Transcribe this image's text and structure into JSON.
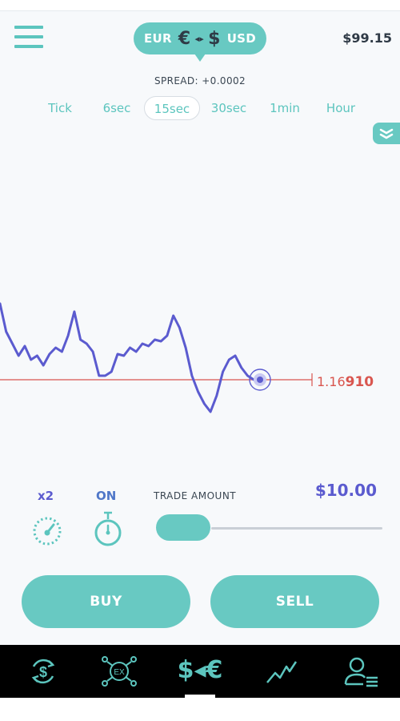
{
  "header": {
    "base_currency": "EUR",
    "base_symbol": "€",
    "swap_symbol": "◂▸",
    "quote_symbol": "$",
    "quote_currency": "USD",
    "balance": "$99.15"
  },
  "spread": "SPREAD: +0.0002",
  "tabs": [
    {
      "label": "Tick",
      "active": false
    },
    {
      "label": "6sec",
      "active": false
    },
    {
      "label": "15sec",
      "active": true
    },
    {
      "label": "30sec",
      "active": false
    },
    {
      "label": "1min",
      "active": false
    },
    {
      "label": "Hour",
      "active": false
    }
  ],
  "chart": {
    "price_prefix": "1.16",
    "price_suffix": "910",
    "line_color": "#5b5bcf",
    "price_line_color": "#d9564f",
    "series": [
      0.3,
      0.55,
      0.6,
      0.74,
      0.78,
      0.66,
      0.7,
      0.8,
      0.76,
      0.82,
      0.7,
      0.58,
      0.64,
      0.6,
      0.45,
      0.12,
      0.48,
      0.66,
      0.8,
      0.74,
      0.86,
      0.82,
      0.9,
      0.58,
      0.66,
      0.6,
      0.56,
      0.52,
      0.5,
      0.48,
      0.18,
      0.44,
      0.58,
      0.95,
      1.04,
      1.2,
      1.34,
      1.27,
      0.96,
      0.68,
      0.72,
      0.88,
      0.96,
      0.94
    ]
  },
  "trade": {
    "multiplier": "x2",
    "timer": "ON",
    "amount_title": "TRADE AMOUNT",
    "amount": "$10.00",
    "amount_fraction": 0.0,
    "buy_label": "BUY",
    "sell_label": "SELL"
  },
  "nav": {
    "center_label": "$◂€",
    "ex_label": "EX"
  },
  "colors": {
    "accent": "#68c9c2",
    "accent_dark": "#5cc5be",
    "nav_bg": "#000000"
  }
}
